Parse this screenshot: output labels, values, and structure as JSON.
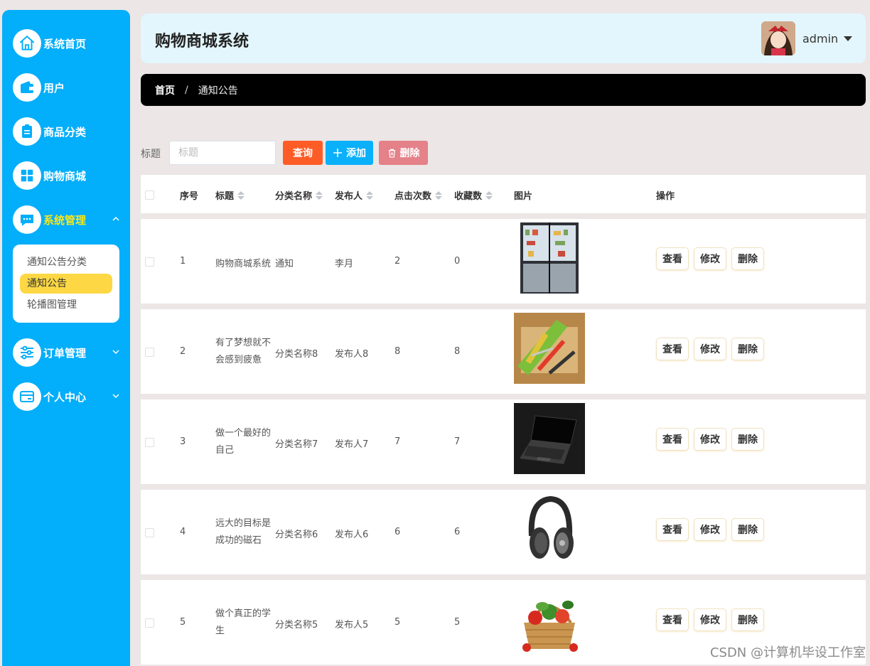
{
  "sidebar": {
    "items": [
      {
        "label": "系统首页",
        "icon": "home-icon"
      },
      {
        "label": "用户",
        "icon": "wallet-icon"
      },
      {
        "label": "商品分类",
        "icon": "clipboard-icon"
      },
      {
        "label": "购物商城",
        "icon": "grid-icon"
      },
      {
        "label": "系统管理",
        "icon": "chat-icon",
        "active": true
      },
      {
        "label": "订单管理",
        "icon": "sliders-icon"
      },
      {
        "label": "个人中心",
        "icon": "card-icon"
      }
    ],
    "submenu": [
      "通知公告分类",
      "通知公告",
      "轮播图管理"
    ],
    "submenu_selected": "通知公告",
    "accent_color": "#03aefa",
    "active_color": "#f8e71c"
  },
  "header": {
    "title": "购物商城系统",
    "username": "admin",
    "bg_color": "#e3f6fd"
  },
  "breadcrumb": {
    "home": "首页",
    "separator": "/",
    "current": "通知公告"
  },
  "search": {
    "label": "标题",
    "placeholder": "标题",
    "value": ""
  },
  "buttons": {
    "query": "查询",
    "add": "添加",
    "delete": "删除"
  },
  "table": {
    "columns": [
      "序号",
      "标题",
      "分类名称",
      "发布人",
      "点击次数",
      "收藏数",
      "图片",
      "操作"
    ],
    "actions": {
      "view": "查看",
      "edit": "修改",
      "delete": "删除"
    },
    "rows": [
      {
        "no": "1",
        "title": "购物商城系统",
        "category": "通知",
        "publisher": "李月",
        "clicks": "2",
        "favorites": "0",
        "image": "refrigerator"
      },
      {
        "no": "2",
        "title": "有了梦想就不会感到疲惫",
        "category": "分类名称8",
        "publisher": "发布人8",
        "clicks": "8",
        "favorites": "8",
        "image": "tools"
      },
      {
        "no": "3",
        "title": "做一个最好的自己",
        "category": "分类名称7",
        "publisher": "发布人7",
        "clicks": "7",
        "favorites": "7",
        "image": "laptop"
      },
      {
        "no": "4",
        "title": "远大的目标是成功的磁石",
        "category": "分类名称6",
        "publisher": "发布人6",
        "clicks": "6",
        "favorites": "6",
        "image": "headphones"
      },
      {
        "no": "5",
        "title": "做个真正的学生",
        "category": "分类名称5",
        "publisher": "发布人5",
        "clicks": "5",
        "favorites": "5",
        "image": "vegetables"
      }
    ]
  },
  "watermark": "CSDN @计算机毕设工作室"
}
